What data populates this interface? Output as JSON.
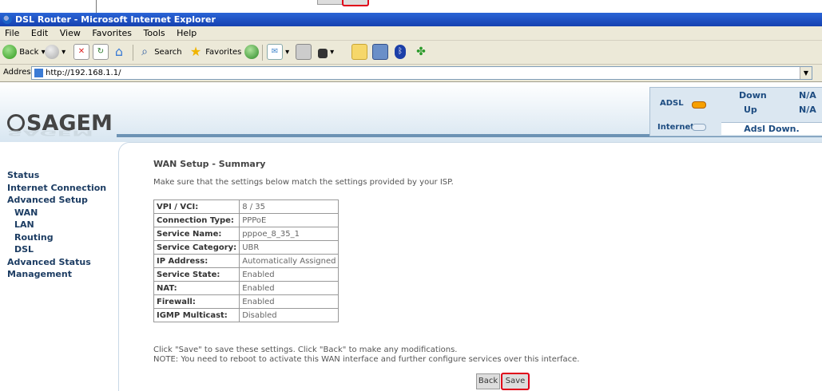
{
  "window": {
    "title": "DSL Router - Microsoft Internet Explorer"
  },
  "menu": [
    "File",
    "Edit",
    "View",
    "Favorites",
    "Tools",
    "Help"
  ],
  "toolbar": {
    "back": "Back",
    "search": "Search",
    "favorites": "Favorites"
  },
  "address": {
    "label": "Address",
    "url": "http://192.168.1.1/"
  },
  "brand": {
    "logo": "SAGEM"
  },
  "status": {
    "adsl_label": "ADSL",
    "internet_label": "Internet",
    "down_label": "Down",
    "down_value": "N/A",
    "up_label": "Up",
    "up_value": "N/A",
    "internet_state": "Adsl Down."
  },
  "nav": {
    "status": "Status",
    "internet_connection": "Internet Connection",
    "advanced_setup": "Advanced Setup",
    "wan": "WAN",
    "lan": "LAN",
    "routing": "Routing",
    "dsl": "DSL",
    "advanced_status": "Advanced Status",
    "management": "Management"
  },
  "content": {
    "title": "WAN Setup - Summary",
    "intro": "Make sure that the settings below match the settings provided by your ISP.",
    "rows": [
      {
        "key": "VPI / VCI:",
        "value": "8 / 35"
      },
      {
        "key": "Connection Type:",
        "value": "PPPoE"
      },
      {
        "key": "Service Name:",
        "value": "pppoe_8_35_1"
      },
      {
        "key": "Service Category:",
        "value": "UBR"
      },
      {
        "key": "IP Address:",
        "value": "Automatically Assigned"
      },
      {
        "key": "Service State:",
        "value": "Enabled"
      },
      {
        "key": "NAT:",
        "value": "Enabled"
      },
      {
        "key": "Firewall:",
        "value": "Enabled"
      },
      {
        "key": "IGMP Multicast:",
        "value": "Disabled"
      }
    ],
    "note1": "Click \"Save\" to save these settings. Click \"Back\" to make any modifications.",
    "note2": "NOTE: You need to reboot to activate this WAN interface and further configure services over this interface.",
    "back_label": "Back",
    "save_label": "Save"
  }
}
